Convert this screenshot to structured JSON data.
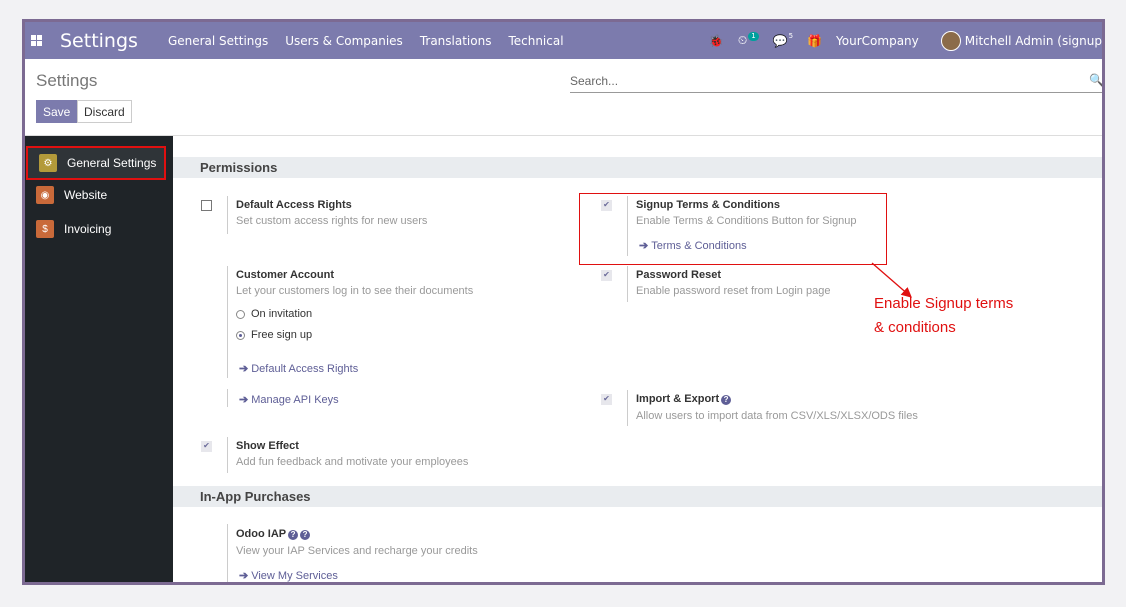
{
  "topbar": {
    "app_title": "Settings",
    "menus": [
      "General Settings",
      "Users & Companies",
      "Translations",
      "Technical"
    ],
    "activity_count": "1",
    "messages_count": "5",
    "company": "YourCompany",
    "user": "Mitchell Admin (signup"
  },
  "control": {
    "breadcrumb": "Settings",
    "search_placeholder": "Search...",
    "save_label": "Save",
    "discard_label": "Discard"
  },
  "sidebar": {
    "items": [
      {
        "label": "General Settings",
        "icon": "gear-icon",
        "color": "#b39a3a"
      },
      {
        "label": "Website",
        "icon": "globe-icon",
        "color": "#c96a3a"
      },
      {
        "label": "Invoicing",
        "icon": "invoice-icon",
        "color": "#c96a3a"
      }
    ]
  },
  "sections": {
    "permissions": "Permissions",
    "iap": "In-App Purchases"
  },
  "settings": {
    "default_access": {
      "title": "Default Access Rights",
      "desc": "Set custom access rights for new users"
    },
    "signup_terms": {
      "title": "Signup Terms & Conditions",
      "desc": "Enable Terms & Conditions Button for Signup",
      "link": "Terms & Conditions"
    },
    "customer_account": {
      "title": "Customer Account",
      "desc": "Let your customers log in to see their documents",
      "opt1": "On invitation",
      "opt2": "Free sign up",
      "link": "Default Access Rights"
    },
    "password_reset": {
      "title": "Password Reset",
      "desc": "Enable password reset from Login page"
    },
    "api_keys": {
      "link": "Manage API Keys"
    },
    "import_export": {
      "title": "Import & Export",
      "desc": "Allow users to import data from CSV/XLS/XLSX/ODS files"
    },
    "show_effect": {
      "title": "Show Effect",
      "desc": "Add fun feedback and motivate your employees"
    },
    "odoo_iap": {
      "title": "Odoo IAP",
      "desc": "View your IAP Services and recharge your credits",
      "link": "View My Services"
    }
  },
  "annotation": {
    "line1": "Enable Signup terms",
    "line2": "& conditions"
  },
  "colors": {
    "brand": "#7c7bad",
    "annotation": "#e01010"
  }
}
